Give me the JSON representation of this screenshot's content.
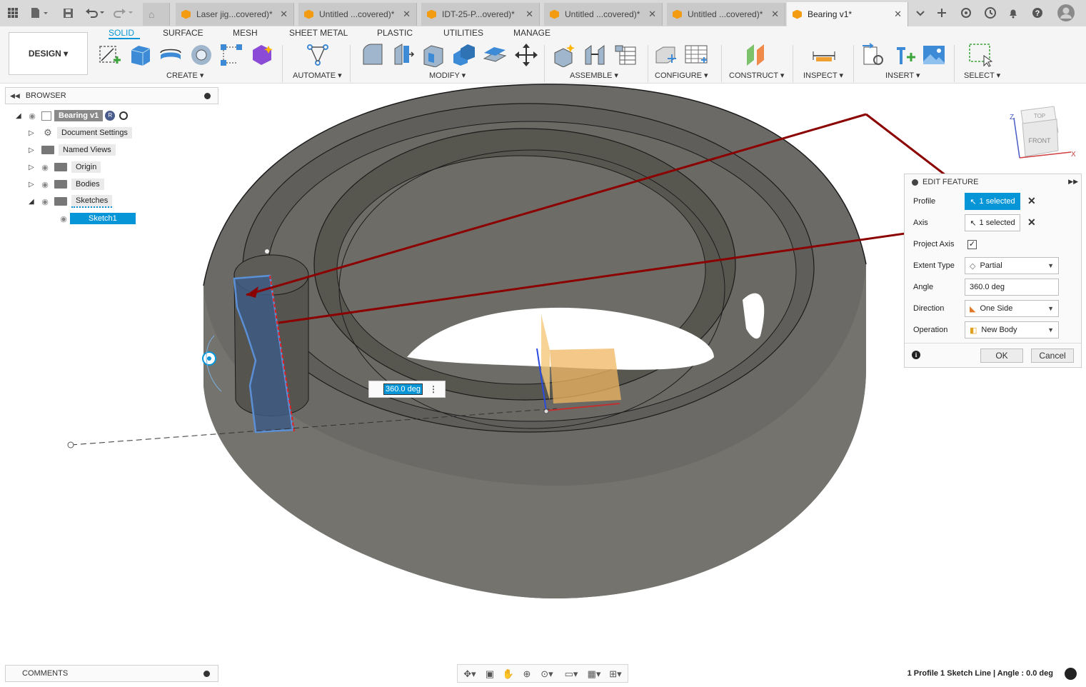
{
  "tabs": [
    {
      "title": "Laser jig...covered)*",
      "close": "✕"
    },
    {
      "title": "Untitled ...covered)*",
      "close": "✕"
    },
    {
      "title": "IDT-25-P...overed)*",
      "close": "✕"
    },
    {
      "title": "Untitled ...covered)*",
      "close": "✕"
    },
    {
      "title": "Untitled ...covered)*",
      "close": "✕"
    },
    {
      "title": "Bearing v1*",
      "close": "✕"
    }
  ],
  "ribbon": {
    "workspace": "DESIGN ▾",
    "tabs": [
      "SOLID",
      "SURFACE",
      "MESH",
      "SHEET METAL",
      "PLASTIC",
      "UTILITIES",
      "MANAGE"
    ],
    "groups": [
      "CREATE ▾",
      "AUTOMATE ▾",
      "MODIFY ▾",
      "ASSEMBLE ▾",
      "CONFIGURE ▾",
      "CONSTRUCT ▾",
      "INSPECT ▾",
      "INSERT ▾",
      "SELECT ▾"
    ]
  },
  "browser": {
    "title": "BROWSER",
    "root": "Bearing v1",
    "root_badge": "R",
    "items": [
      "Document Settings",
      "Named Views",
      "Origin",
      "Bodies",
      "Sketches"
    ],
    "sketch": "Sketch1"
  },
  "edit_feature": {
    "title": "EDIT FEATURE",
    "profile_label": "Profile",
    "profile_value": "1 selected",
    "axis_label": "Axis",
    "axis_value": "1 selected",
    "project_axis_label": "Project Axis",
    "project_axis_checked": true,
    "project_axis_mark": "✓",
    "extent_type_label": "Extent Type",
    "extent_type_value": "Partial",
    "angle_label": "Angle",
    "angle_value": "360.0 deg",
    "direction_label": "Direction",
    "direction_value": "One Side",
    "operation_label": "Operation",
    "operation_value": "New Body",
    "ok": "OK",
    "cancel": "Cancel",
    "info": "i"
  },
  "viewport": {
    "angle_input": "360.0 deg",
    "viewcube_top": "TOP",
    "viewcube_front": "FRONT",
    "axis_z": "Z",
    "axis_x": "X"
  },
  "comments": {
    "label": "COMMENTS"
  },
  "status": "1 Profile 1 Sketch Line | Angle : 0.0 deg",
  "colors": {
    "accent": "#0696d7",
    "body": "#6b6a66",
    "arrow": "#8b0000",
    "tab_icon": "#f39c12"
  }
}
